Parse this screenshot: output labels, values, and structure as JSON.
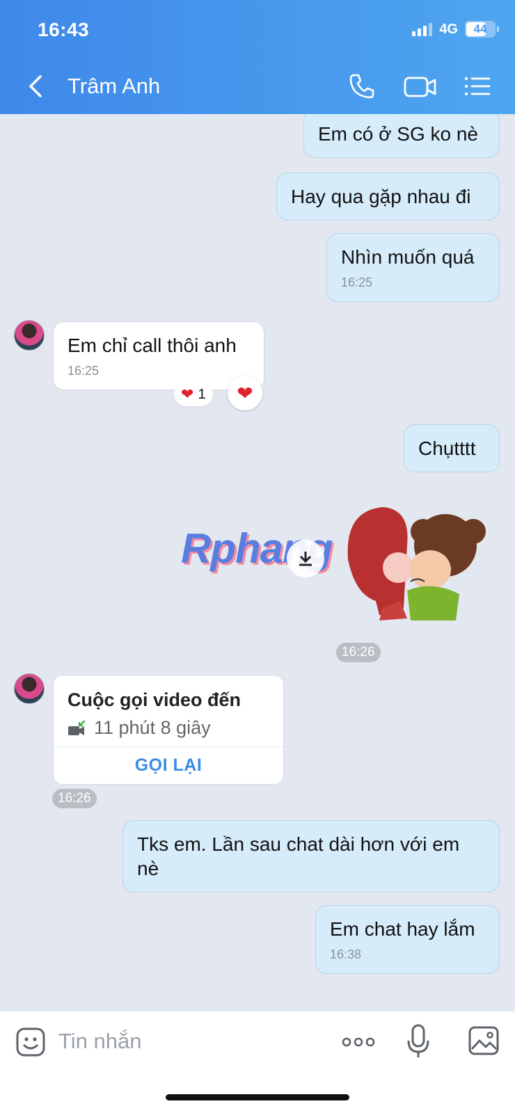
{
  "status_bar": {
    "time": "16:43",
    "network": "4G",
    "battery": "44"
  },
  "header": {
    "title": "Trâm Anh"
  },
  "messages": [
    {
      "text": "Em có ở SG ko nè"
    },
    {
      "text": "Hay qua gặp nhau đi"
    },
    {
      "text": "Nhìn muốn quá",
      "time": "16:25"
    },
    {
      "text": "Em chỉ call thôi anh",
      "time": "16:25",
      "reaction_count": "1"
    },
    {
      "text": "Chụtttt"
    },
    {
      "time": "16:26"
    },
    {
      "call_title": "Cuộc gọi video đến",
      "call_duration": "11 phút 8 giây",
      "callback_label": "GỌI LẠI",
      "time": "16:26"
    },
    {
      "text": "Tks em. Lần sau chat dài hơn với em nè"
    },
    {
      "text": "Em chat hay lắm",
      "time": "16:38"
    }
  ],
  "watermark": "Rphang",
  "composer": {
    "placeholder": "Tin nhắn"
  },
  "colors": {
    "header_start": "#3f88ea",
    "header_end": "#4ea6ef",
    "outgoing_bubble": "#d6ecfb",
    "accent": "#3a8ce6"
  }
}
